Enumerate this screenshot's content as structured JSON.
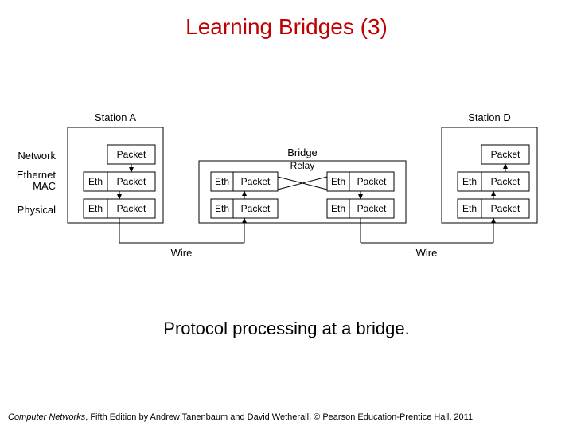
{
  "title": "Learning Bridges (3)",
  "caption": "Protocol processing at a bridge.",
  "footer": {
    "book": "Computer Networks",
    "rest": ", Fifth Edition by Andrew Tanenbaum and David Wetherall, © Pearson Education-Prentice Hall, 2011"
  },
  "labels": {
    "stationA": "Station A",
    "stationD": "Station D",
    "bridge": "Bridge",
    "relay": "Relay",
    "network": "Network",
    "ethmac1": "Ethernet",
    "ethmac2": "MAC",
    "physical": "Physical",
    "wire": "Wire",
    "packet": "Packet",
    "eth": "Eth"
  }
}
